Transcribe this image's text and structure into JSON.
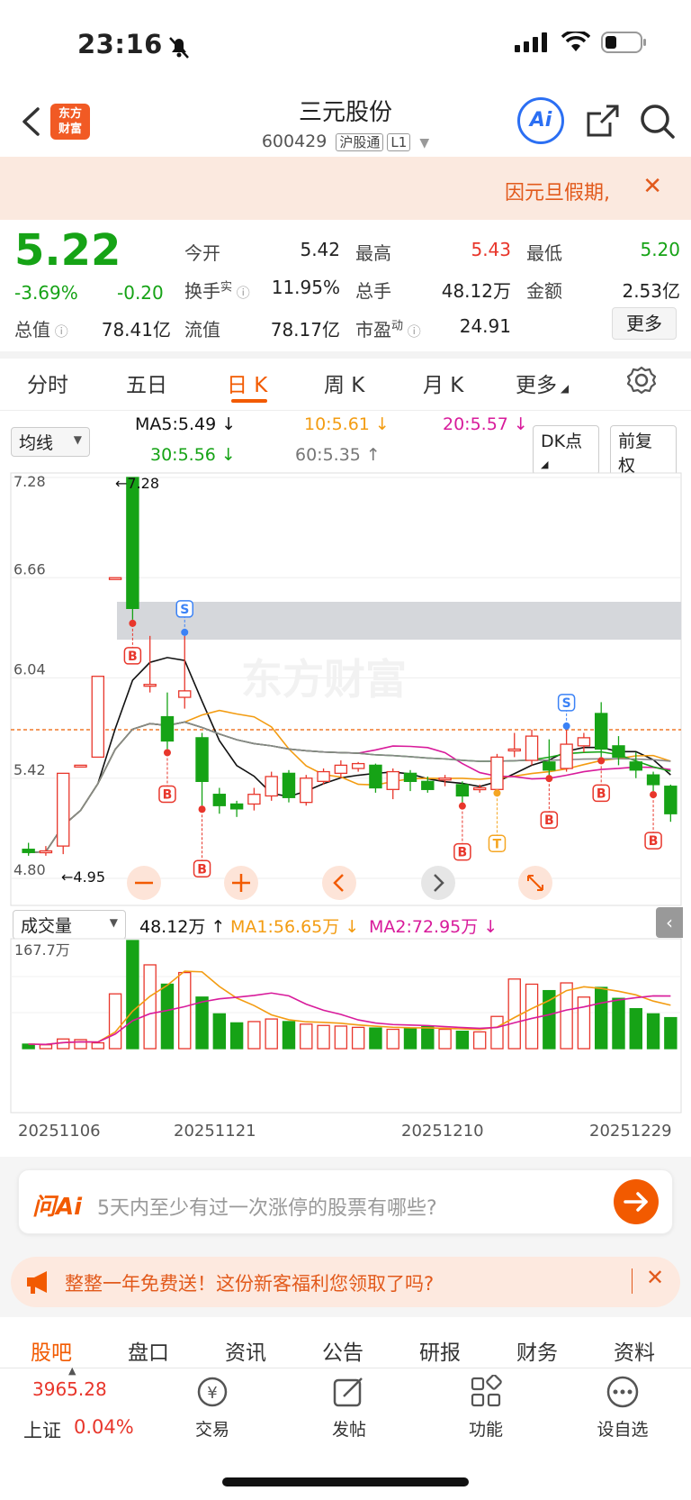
{
  "status_bar": {
    "time": "23:16"
  },
  "header": {
    "back_label": "<",
    "logo_text": "东方财富",
    "title": "三元股份",
    "code": "600429",
    "tag1": "沪股通",
    "tag2": "L1",
    "ai_label": "Ai"
  },
  "notice": {
    "text": "因元旦假期,",
    "close": "✕"
  },
  "quote": {
    "price": "5.22",
    "change_pct": "-3.69%",
    "change": "-0.20",
    "items": [
      {
        "label": "今开",
        "value": "5.42"
      },
      {
        "label": "最高",
        "value": "5.43"
      },
      {
        "label": "最低",
        "value": "5.20"
      },
      {
        "label": "换手",
        "value": "11.95%"
      },
      {
        "label": "总手",
        "value": "48.12万"
      },
      {
        "label": "金额",
        "value": "2.53亿"
      },
      {
        "label": "总值",
        "value": "78.41亿"
      },
      {
        "label": "流值",
        "value": "78.17亿"
      },
      {
        "label": "市盈",
        "value": "24.91"
      }
    ],
    "turnover_sup": "实",
    "pe_sup": "动",
    "more": "更多"
  },
  "tabs": [
    "分时",
    "五日",
    "日 K",
    "周 K",
    "月 K",
    "更多"
  ],
  "ma_bar": {
    "select": "均线",
    "ma5": "MA5:5.49",
    "ma10": "10:5.61",
    "ma20": "20:5.57",
    "ma30": "30:5.56",
    "ma60": "60:5.35",
    "dk": "DK点",
    "adj": "前复权"
  },
  "kline": {
    "y_ticks": [
      "7.28",
      "6.66",
      "6.04",
      "5.42",
      "4.80"
    ],
    "high_label": "7.28",
    "low_label": "4.95",
    "watermark": "东方财富"
  },
  "volume_bar": {
    "select": "成交量",
    "vol": "48.12万",
    "ma1": "MA1:56.65万",
    "ma2": "MA2:72.95万",
    "max_label": "167.7万"
  },
  "x_dates": [
    "20251106",
    "20251121",
    "20251210",
    "20251229"
  ],
  "chart_data": {
    "type": "candlestick",
    "ylim": [
      4.8,
      7.28
    ],
    "x_ticks": [
      "20251106",
      "20251121",
      "20251210",
      "20251229"
    ],
    "volume_max": "167.7万",
    "series": [
      {
        "name": "MA5",
        "last": 5.49
      },
      {
        "name": "MA10",
        "last": 5.61
      },
      {
        "name": "MA20",
        "last": 5.57
      },
      {
        "name": "MA30",
        "last": 5.56
      },
      {
        "name": "MA60",
        "last": 5.35
      }
    ],
    "candles": [
      {
        "o": 4.98,
        "c": 4.96,
        "h": 5.02,
        "l": 4.94
      },
      {
        "o": 4.96,
        "c": 4.97,
        "h": 5.0,
        "l": 4.94
      },
      {
        "o": 5.0,
        "c": 5.45,
        "h": 5.45,
        "l": 4.95
      },
      {
        "o": 5.5,
        "c": 5.5,
        "h": 5.5,
        "l": 5.5
      },
      {
        "o": 5.55,
        "c": 6.05,
        "h": 6.05,
        "l": 5.55
      },
      {
        "o": 6.66,
        "c": 6.66,
        "h": 6.66,
        "l": 6.66
      },
      {
        "o": 7.28,
        "c": 6.47,
        "h": 7.28,
        "l": 6.4
      },
      {
        "o": 6.0,
        "c": 6.0,
        "h": 6.3,
        "l": 5.95
      },
      {
        "o": 5.8,
        "c": 5.65,
        "h": 5.95,
        "l": 5.6
      },
      {
        "o": 5.92,
        "c": 5.96,
        "h": 6.3,
        "l": 5.85
      },
      {
        "o": 5.67,
        "c": 5.4,
        "h": 5.7,
        "l": 5.25
      },
      {
        "o": 5.32,
        "c": 5.25,
        "h": 5.36,
        "l": 5.2
      },
      {
        "o": 5.26,
        "c": 5.23,
        "h": 5.28,
        "l": 5.18
      },
      {
        "o": 5.26,
        "c": 5.32,
        "h": 5.36,
        "l": 5.22
      },
      {
        "o": 5.31,
        "c": 5.43,
        "h": 5.46,
        "l": 5.28
      },
      {
        "o": 5.45,
        "c": 5.3,
        "h": 5.47,
        "l": 5.27
      },
      {
        "o": 5.27,
        "c": 5.42,
        "h": 5.44,
        "l": 5.25
      },
      {
        "o": 5.4,
        "c": 5.46,
        "h": 5.48,
        "l": 5.38
      },
      {
        "o": 5.45,
        "c": 5.5,
        "h": 5.53,
        "l": 5.42
      },
      {
        "o": 5.48,
        "c": 5.51,
        "h": 5.52,
        "l": 5.46
      },
      {
        "o": 5.5,
        "c": 5.36,
        "h": 5.51,
        "l": 5.33
      },
      {
        "o": 5.35,
        "c": 5.46,
        "h": 5.48,
        "l": 5.29
      },
      {
        "o": 5.45,
        "c": 5.4,
        "h": 5.47,
        "l": 5.34
      },
      {
        "o": 5.4,
        "c": 5.35,
        "h": 5.43,
        "l": 5.33
      },
      {
        "o": 5.42,
        "c": 5.42,
        "h": 5.44,
        "l": 5.37
      },
      {
        "o": 5.38,
        "c": 5.31,
        "h": 5.4,
        "l": 5.27
      },
      {
        "o": 5.36,
        "c": 5.36,
        "h": 5.38,
        "l": 5.33
      },
      {
        "o": 5.35,
        "c": 5.55,
        "h": 5.57,
        "l": 5.35
      },
      {
        "o": 5.6,
        "c": 5.6,
        "h": 5.7,
        "l": 5.55
      },
      {
        "o": 5.53,
        "c": 5.68,
        "h": 5.72,
        "l": 5.5
      },
      {
        "o": 5.52,
        "c": 5.47,
        "h": 5.66,
        "l": 5.44
      },
      {
        "o": 5.48,
        "c": 5.63,
        "h": 5.72,
        "l": 5.46
      },
      {
        "o": 5.62,
        "c": 5.67,
        "h": 5.7,
        "l": 5.58
      },
      {
        "o": 5.82,
        "c": 5.6,
        "h": 5.89,
        "l": 5.55
      },
      {
        "o": 5.62,
        "c": 5.55,
        "h": 5.68,
        "l": 5.5
      },
      {
        "o": 5.52,
        "c": 5.47,
        "h": 5.58,
        "l": 5.42
      },
      {
        "o": 5.44,
        "c": 5.38,
        "h": 5.46,
        "l": 5.34
      },
      {
        "o": 5.37,
        "c": 5.2,
        "h": 5.38,
        "l": 5.15
      }
    ],
    "volumes": [
      7,
      6,
      15,
      14,
      9,
      85,
      167.7,
      130,
      100,
      118,
      80,
      54,
      40,
      42,
      46,
      42,
      38,
      36,
      35,
      33,
      32,
      30,
      32,
      34,
      30,
      27,
      26,
      50,
      108,
      100,
      90,
      102,
      80,
      95,
      78,
      62,
      54,
      48.12
    ]
  },
  "ai_bar": {
    "logo": "问Ai",
    "placeholder": "5天内至少有过一次涨停的股票有哪些?"
  },
  "promo": {
    "text": "整整一年免费送！这份新客福利您领取了吗?"
  },
  "bottom_tabs": [
    "股吧",
    "盘口",
    "资讯",
    "公告",
    "研报",
    "财务",
    "资料"
  ],
  "nav": {
    "index_value": "3965.28",
    "index_name": "上证",
    "index_change": "0.04%",
    "trade": "交易",
    "post": "发帖",
    "function": "功能",
    "watch": "设自选"
  }
}
